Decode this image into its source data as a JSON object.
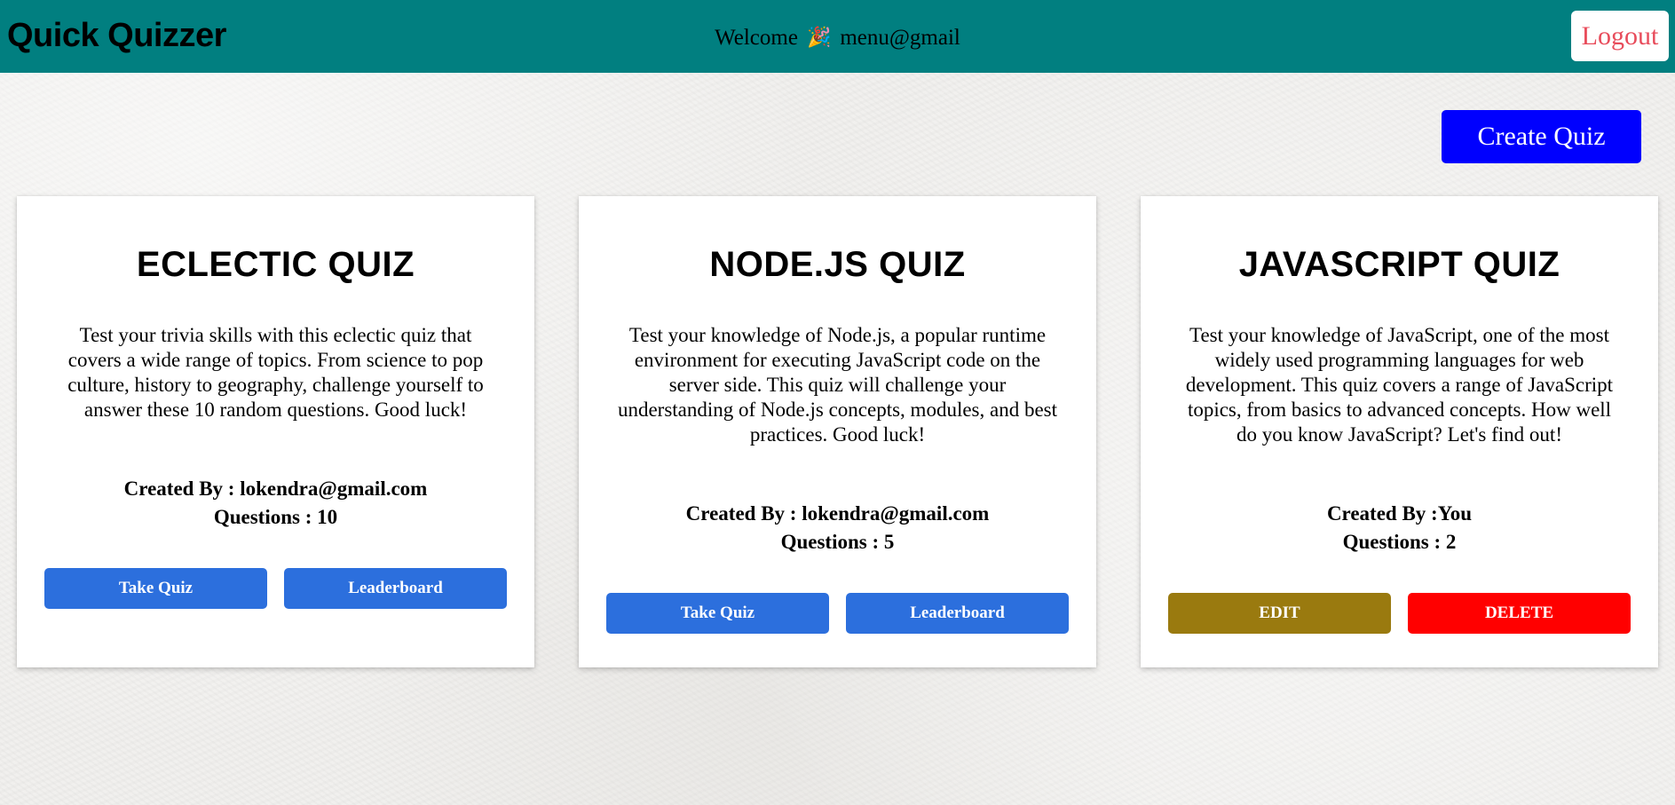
{
  "header": {
    "brand": "Quick Quizzer",
    "welcome_prefix": "Welcome",
    "welcome_icon": "party-popper-icon",
    "welcome_emoji": "🎉",
    "user_email": "menu@gmail",
    "logout_label": "Logout"
  },
  "actions": {
    "create_quiz_label": "Create Quiz"
  },
  "quizzes": [
    {
      "title": "ECLECTIC QUIZ",
      "description": "Test your trivia skills with this eclectic quiz that covers a wide range of topics. From science to pop culture, history to geography, challenge yourself to answer these 10 random questions. Good luck!",
      "created_by": "Created By : lokendra@gmail.com",
      "questions": "Questions : 10",
      "primary_label": "Take Quiz",
      "secondary_label": "Leaderboard"
    },
    {
      "title": "NODE.JS QUIZ",
      "description": "Test your knowledge of Node.js, a popular runtime environment for executing JavaScript code on the server side. This quiz will challenge your understanding of Node.js concepts, modules, and best practices. Good luck!",
      "created_by": "Created By : lokendra@gmail.com",
      "questions": "Questions : 5",
      "primary_label": "Take Quiz",
      "secondary_label": "Leaderboard"
    },
    {
      "title": "JAVASCRIPT QUIZ",
      "description": "Test your knowledge of JavaScript, one of the most widely used programming languages for web development. This quiz covers a range of JavaScript topics, from basics to advanced concepts. How well do you know JavaScript? Let's find out!",
      "created_by": "Created By :You",
      "questions": "Questions : 2",
      "primary_label": "EDIT",
      "secondary_label": "DELETE"
    }
  ],
  "colors": {
    "navbar": "#017f80",
    "create_button": "#0000fe",
    "primary_button": "#2c6fdd",
    "edit_button": "#9a7a0f",
    "delete_button": "#ff0000",
    "logout_text": "#e84c5b"
  }
}
